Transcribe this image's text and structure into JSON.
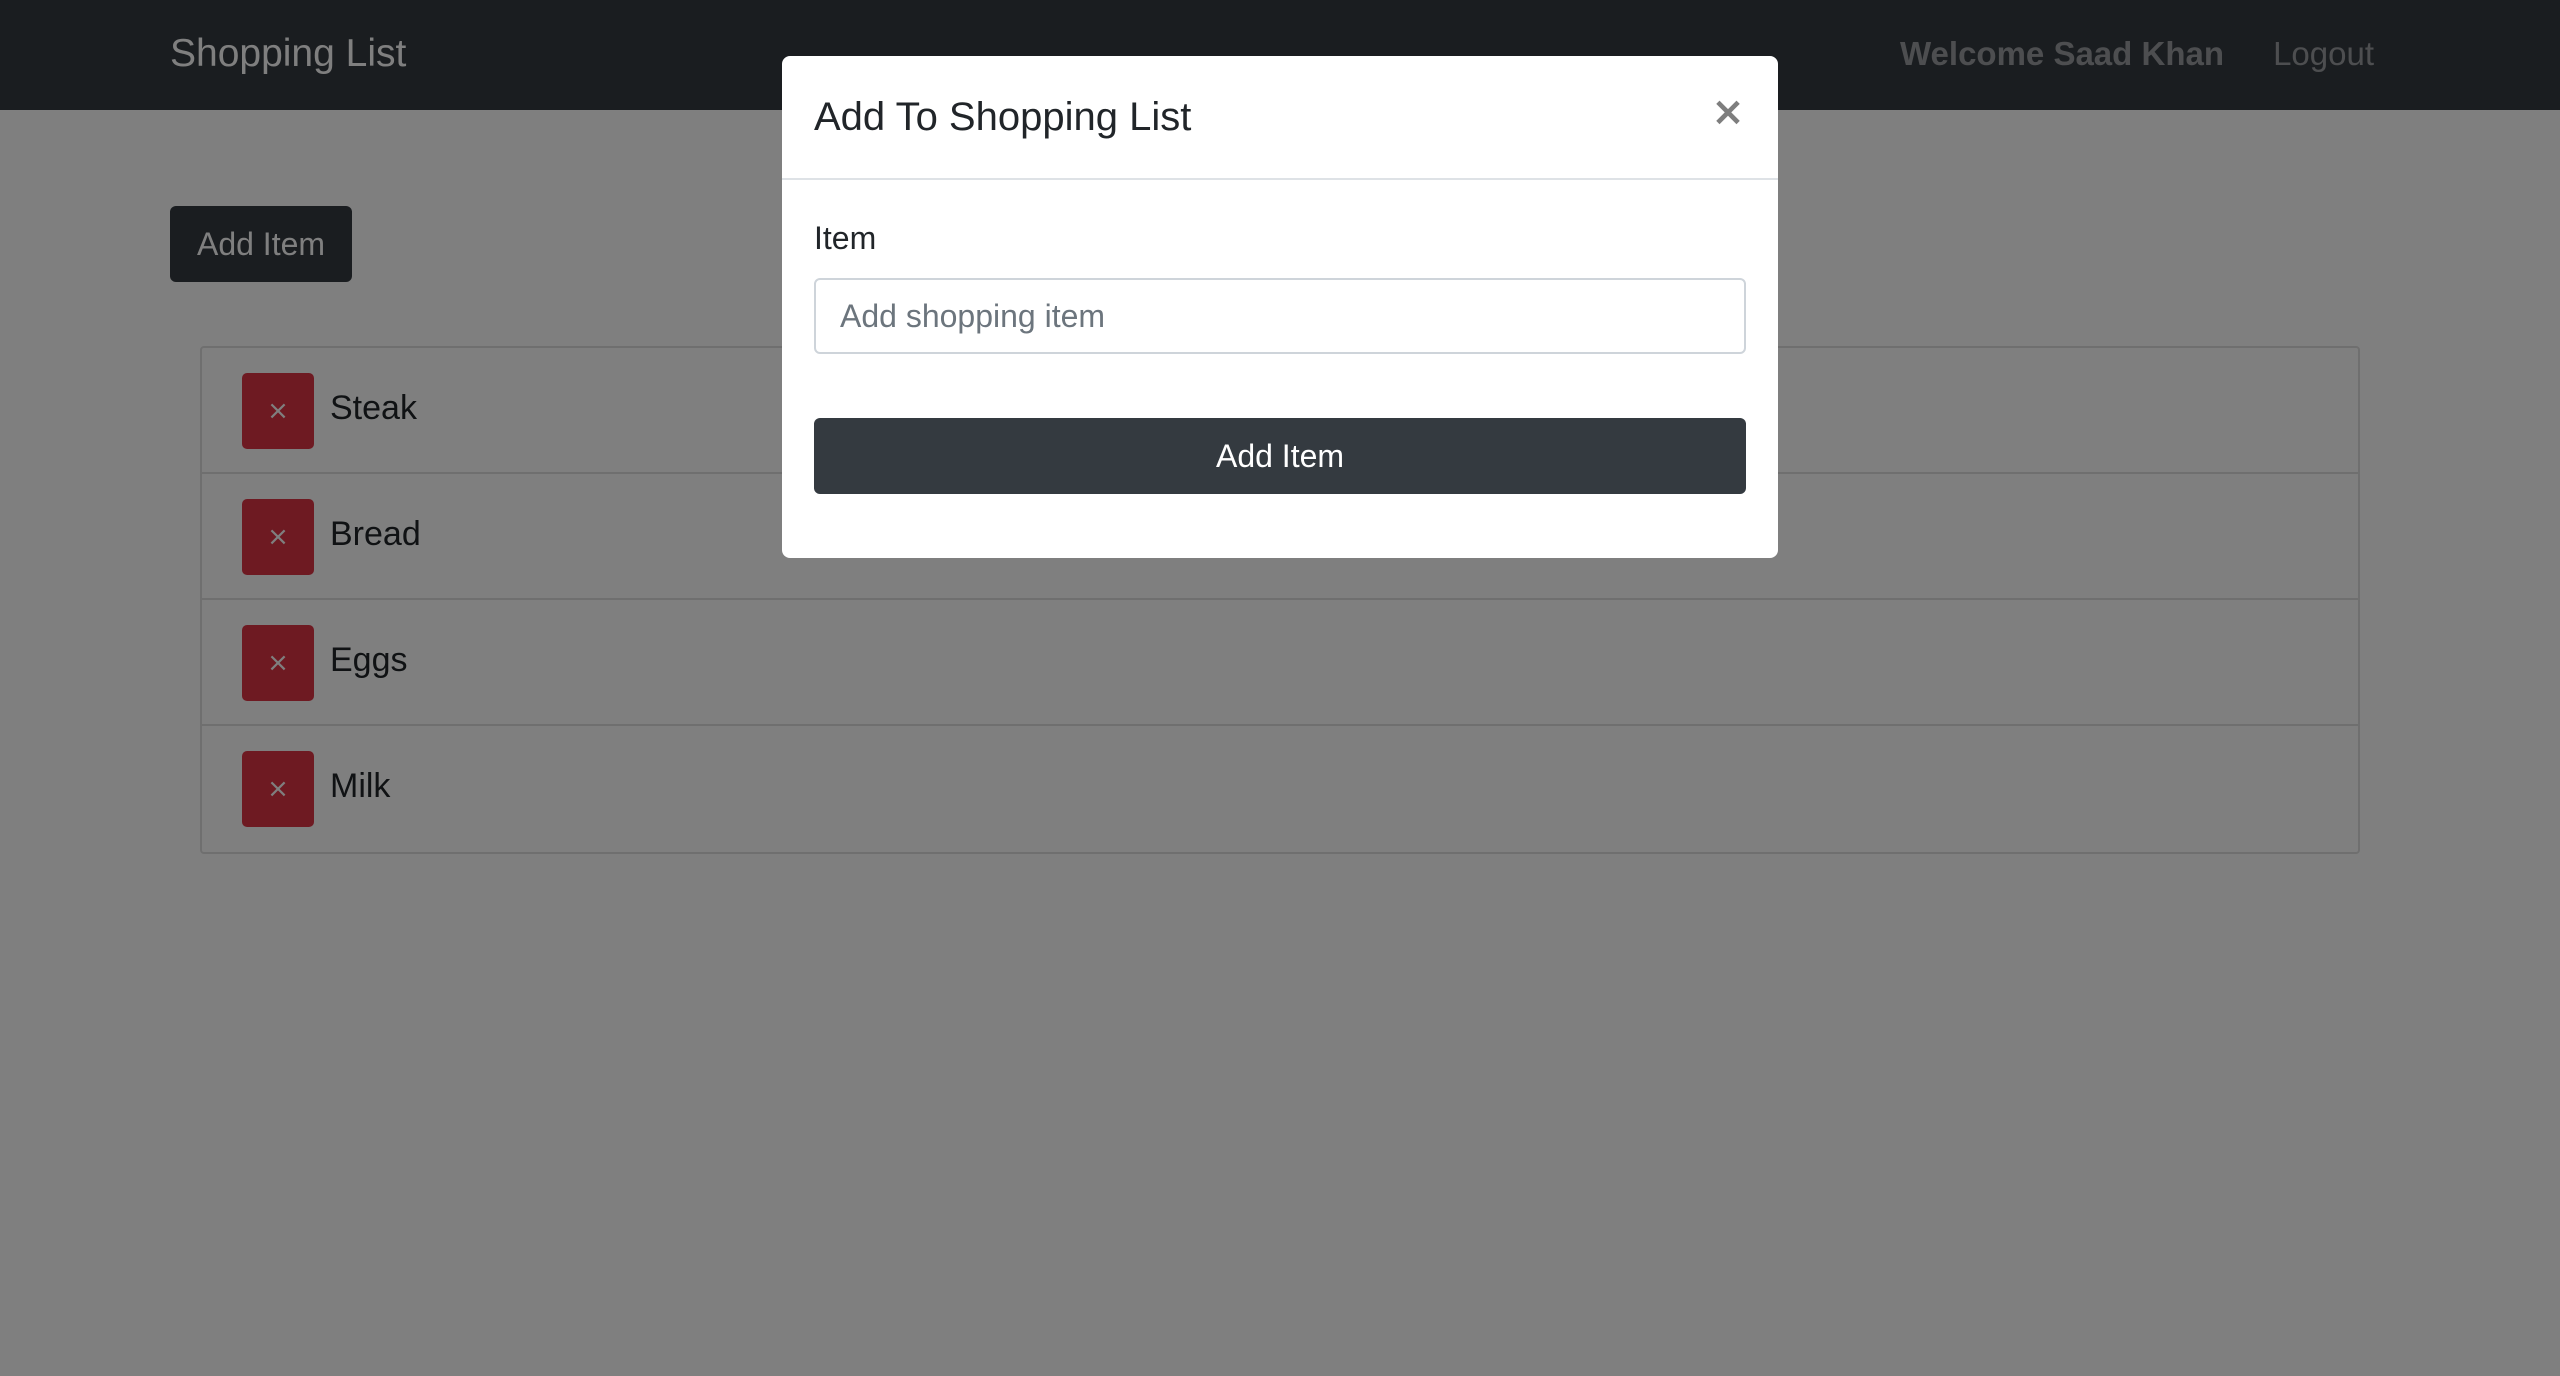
{
  "navbar": {
    "brand": "Shopping List",
    "welcome": "Welcome Saad Khan",
    "logout": "Logout"
  },
  "main": {
    "add_button_label": "Add Item",
    "items": [
      {
        "name": "Steak",
        "remove_icon": "×"
      },
      {
        "name": "Bread",
        "remove_icon": "×"
      },
      {
        "name": "Eggs",
        "remove_icon": "×"
      },
      {
        "name": "Milk",
        "remove_icon": "×"
      }
    ]
  },
  "modal": {
    "title": "Add To Shopping List",
    "close_icon": "×",
    "field_label": "Item",
    "input_placeholder": "Add shopping item",
    "input_value": "",
    "submit_label": "Add Item"
  },
  "colors": {
    "navbar_bg": "#343a40",
    "danger": "#dc3545",
    "dark_button": "#343a40",
    "backdrop": "rgba(0,0,0,0.5)"
  },
  "icons": {
    "remove": "close-icon",
    "modal_close": "close-icon"
  }
}
